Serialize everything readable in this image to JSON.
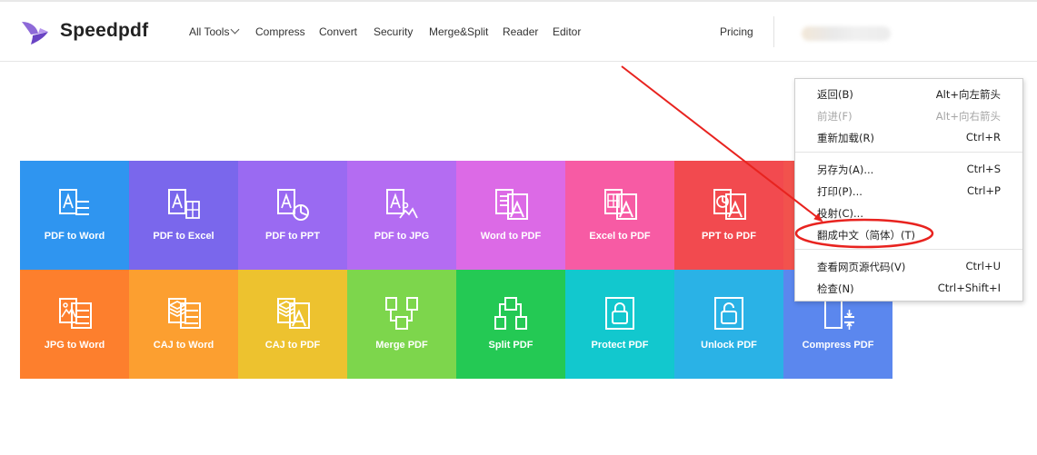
{
  "header": {
    "brand": "Speedpdf",
    "nav": [
      "All Tools",
      "Compress",
      "Convert",
      "Security",
      "Merge&Split",
      "Reader",
      "Editor"
    ],
    "pricing": "Pricing"
  },
  "tools": [
    {
      "label": "PDF to Word",
      "icon": "pdf-to-word-icon",
      "color": "#2f95f0"
    },
    {
      "label": "PDF to Excel",
      "icon": "pdf-to-excel-icon",
      "color": "#7a67ec"
    },
    {
      "label": "PDF to PPT",
      "icon": "pdf-to-ppt-icon",
      "color": "#9a6af2"
    },
    {
      "label": "PDF to JPG",
      "icon": "pdf-to-jpg-icon",
      "color": "#b46cf2"
    },
    {
      "label": "Word to PDF",
      "icon": "word-to-pdf-icon",
      "color": "#dc6ae6"
    },
    {
      "label": "Excel to PDF",
      "icon": "excel-to-pdf-icon",
      "color": "#f75ba4"
    },
    {
      "label": "PPT to PDF",
      "icon": "ppt-to-pdf-icon",
      "color": "#f24a4f"
    },
    {
      "label": "",
      "icon": "",
      "color": "#f2524d"
    },
    {
      "label": "JPG to Word",
      "icon": "jpg-to-word-icon",
      "color": "#fd7f2d"
    },
    {
      "label": "CAJ to Word",
      "icon": "caj-to-word-icon",
      "color": "#fc9f30"
    },
    {
      "label": "CAJ to PDF",
      "icon": "caj-to-pdf-icon",
      "color": "#edc22f"
    },
    {
      "label": "Merge PDF",
      "icon": "merge-pdf-icon",
      "color": "#7dd64c"
    },
    {
      "label": "Split PDF",
      "icon": "split-pdf-icon",
      "color": "#24c954"
    },
    {
      "label": "Protect PDF",
      "icon": "protect-pdf-icon",
      "color": "#12c8ce"
    },
    {
      "label": "Unlock PDF",
      "icon": "unlock-pdf-icon",
      "color": "#2ab2e6"
    },
    {
      "label": "Compress PDF",
      "icon": "compress-pdf-icon",
      "color": "#5b87ee"
    }
  ],
  "context_menu": {
    "items": [
      {
        "label": "返回(B)",
        "shortcut": "Alt+向左箭头",
        "disabled": false
      },
      {
        "label": "前进(F)",
        "shortcut": "Alt+向右箭头",
        "disabled": true
      },
      {
        "label": "重新加载(R)",
        "shortcut": "Ctrl+R",
        "disabled": false
      },
      {
        "label": "另存为(A)...",
        "shortcut": "Ctrl+S",
        "disabled": false
      },
      {
        "label": "打印(P)...",
        "shortcut": "Ctrl+P",
        "disabled": false
      },
      {
        "label": "投射(C)...",
        "shortcut": "",
        "disabled": false
      },
      {
        "label": "翻成中文（简体）(T)",
        "shortcut": "",
        "disabled": false
      },
      {
        "label": "查看网页源代码(V)",
        "shortcut": "Ctrl+U",
        "disabled": false
      },
      {
        "label": "检查(N)",
        "shortcut": "Ctrl+Shift+I",
        "disabled": false
      }
    ]
  },
  "annotation_color": "#e8231f"
}
